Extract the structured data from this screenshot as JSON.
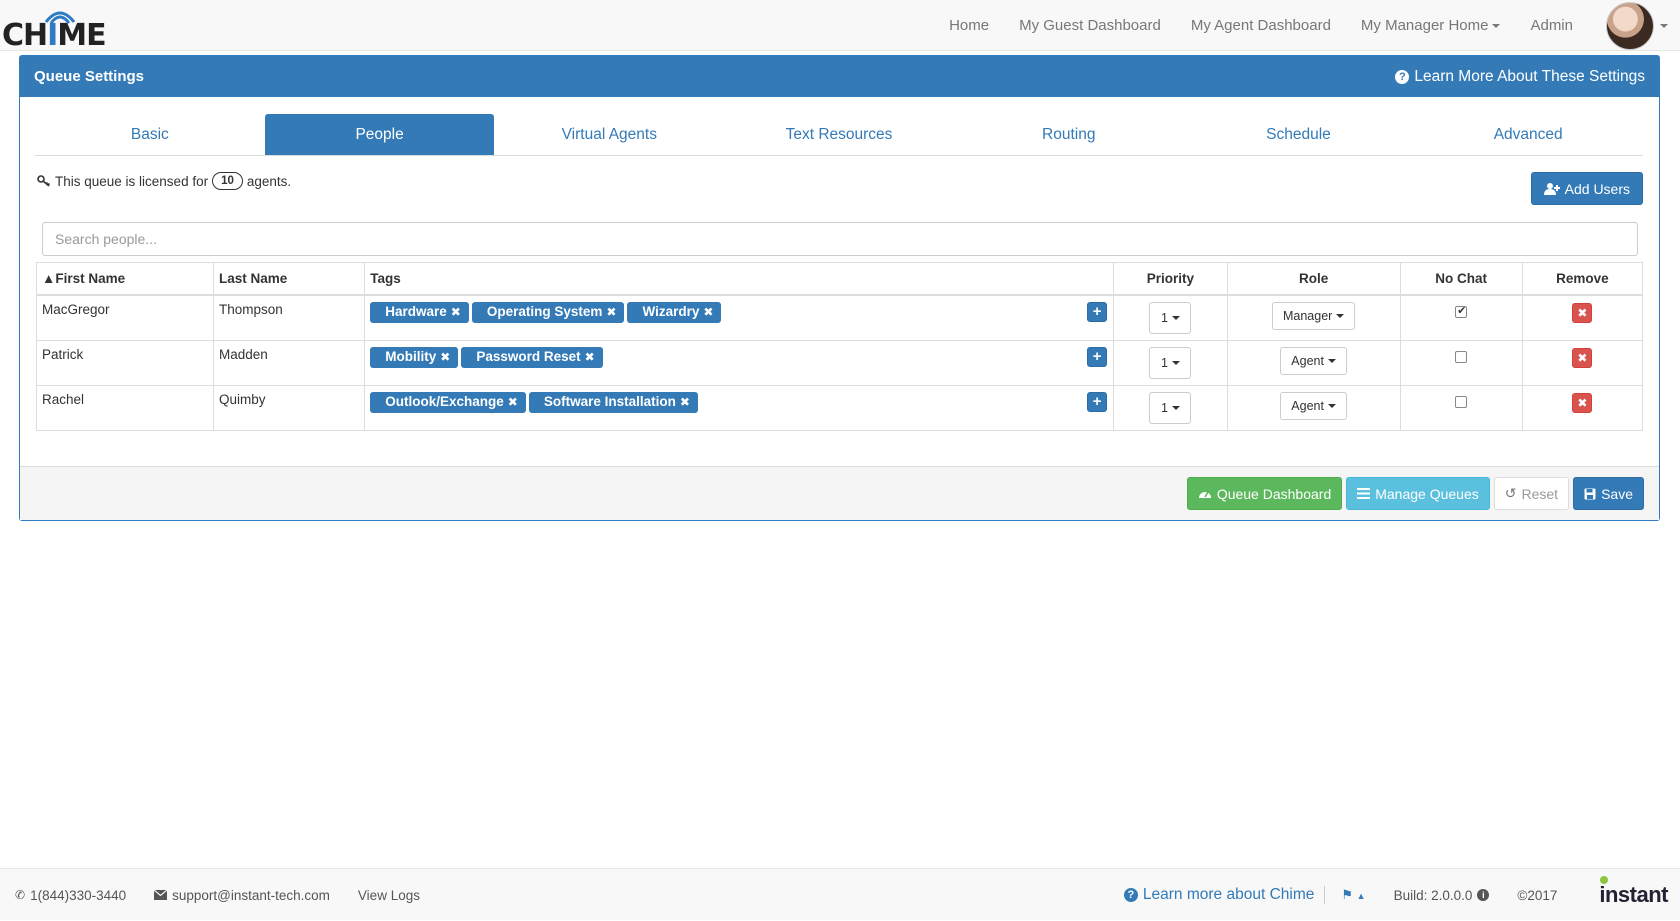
{
  "nav": {
    "logo_text_pre": "CH",
    "logo_text_m": "I",
    "logo_text_post": "ME",
    "links": [
      "Home",
      "My Guest Dashboard",
      "My Agent Dashboard",
      "My Manager Home",
      "Admin"
    ]
  },
  "panel": {
    "title": "Queue Settings",
    "help": "Learn More About These Settings"
  },
  "tabs": [
    "Basic",
    "People",
    "Virtual Agents",
    "Text Resources",
    "Routing",
    "Schedule",
    "Advanced"
  ],
  "active_tab": "People",
  "license": {
    "prefix": "This queue is licensed for",
    "count": "10",
    "suffix": "agents."
  },
  "add_users_label": "Add Users",
  "search_placeholder": "Search people...",
  "table": {
    "headers": {
      "first": "▲First Name",
      "last": "Last Name",
      "tags": "Tags",
      "priority": "Priority",
      "role": "Role",
      "nochat": "No Chat",
      "remove": "Remove"
    },
    "rows": [
      {
        "first": "MacGregor",
        "last": "Thompson",
        "tags": [
          "Hardware",
          "Operating System",
          "Wizardry"
        ],
        "priority": "1",
        "role": "Manager",
        "nochat": true
      },
      {
        "first": "Patrick",
        "last": "Madden",
        "tags": [
          "Mobility",
          "Password Reset"
        ],
        "priority": "1",
        "role": "Agent",
        "nochat": false
      },
      {
        "first": "Rachel",
        "last": "Quimby",
        "tags": [
          "Outlook/Exchange",
          "Software Installation"
        ],
        "priority": "1",
        "role": "Agent",
        "nochat": false
      }
    ]
  },
  "footer_buttons": {
    "dashboard": "Queue Dashboard",
    "manage": "Manage Queues",
    "reset": "Reset",
    "save": "Save"
  },
  "page_footer": {
    "phone": "1(844)330-3440",
    "email": "support@instant-tech.com",
    "logs": "View Logs",
    "learn": "Learn more about Chime",
    "build": "Build: 2.0.0.0",
    "copyright": "©2017",
    "brand": "instant"
  },
  "colors": {
    "primary": "#337ab7",
    "success": "#5cb85c",
    "info": "#5bc0de",
    "danger": "#d9534f"
  }
}
